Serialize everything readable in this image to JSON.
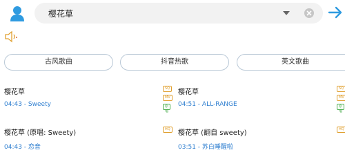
{
  "search": {
    "query": "樱花草"
  },
  "categories": [
    "古风歌曲",
    "抖音热歌",
    "英文歌曲"
  ],
  "songs": [
    {
      "title": "樱花草",
      "duration": "04:43",
      "artist": "Sweety",
      "badges": [
        "SQ",
        "MV",
        "原唱"
      ]
    },
    {
      "title": "樱花草",
      "duration": "04:51",
      "artist": "ALL-RANGE",
      "badges": [
        "SQ",
        "MV",
        "原唱"
      ]
    },
    {
      "title": "樱花草 (原唱: Sweety)",
      "duration": "04:43",
      "artist": "恋音",
      "badges": [
        "HQ"
      ]
    },
    {
      "title": "樱花草 (翻自 sweety)",
      "duration": "03:51",
      "artist": "苏白睡醒啦",
      "badges": [
        "HQ"
      ]
    }
  ],
  "colors": {
    "accent": "#2f7fd0",
    "badge": "#e0a030",
    "badge_original": "#4caf50"
  }
}
